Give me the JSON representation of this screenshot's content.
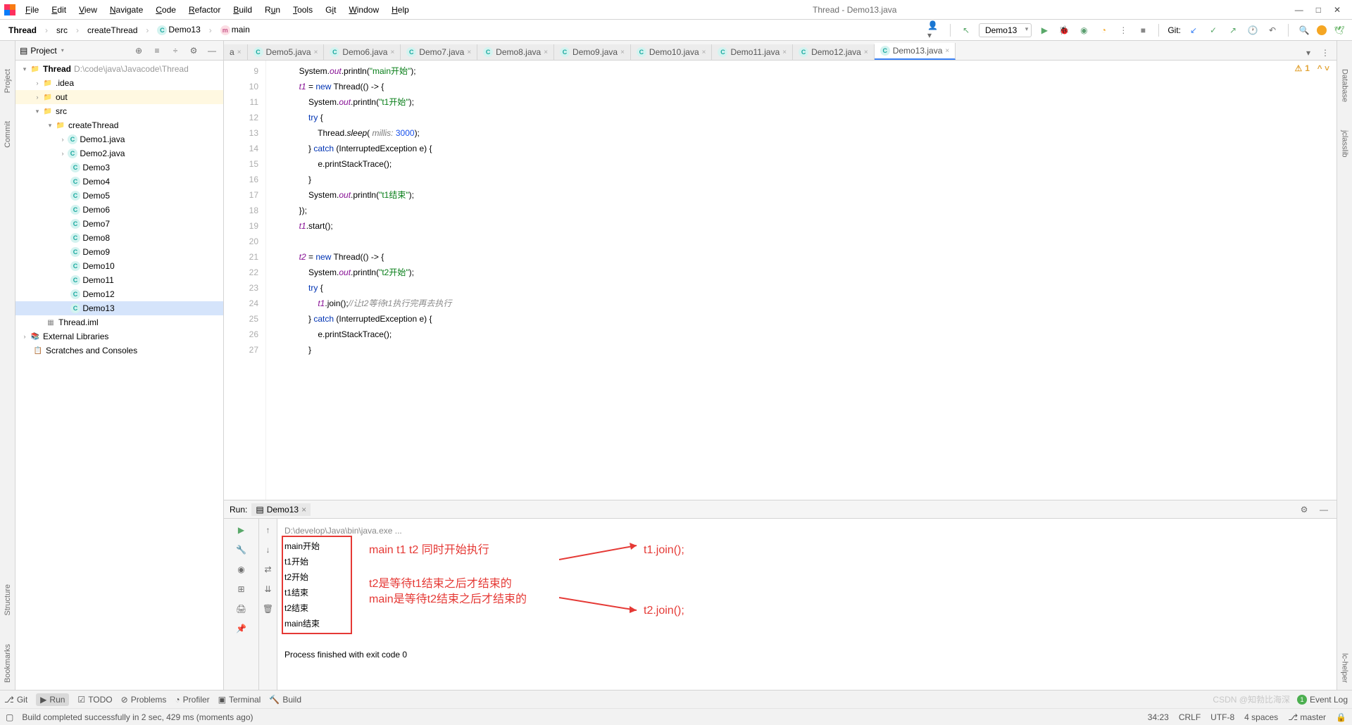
{
  "window": {
    "title": "Thread - Demo13.java"
  },
  "menu": [
    "File",
    "Edit",
    "View",
    "Navigate",
    "Code",
    "Refactor",
    "Build",
    "Run",
    "Tools",
    "Git",
    "Window",
    "Help"
  ],
  "breadcrumb": {
    "root": "Thread",
    "src": "src",
    "pkg": "createThread",
    "cls": "Demo13",
    "method": "main"
  },
  "runConfig": "Demo13",
  "gitLabel": "Git:",
  "project": {
    "title": "Project",
    "root": "Thread",
    "rootPath": "D:\\code\\java\\Javacode\\Thread",
    "idea": ".idea",
    "out": "out",
    "src": "src",
    "pkg": "createThread",
    "files": [
      "Demo1.java",
      "Demo2.java",
      "Demo3",
      "Demo4",
      "Demo5",
      "Demo6",
      "Demo7",
      "Demo8",
      "Demo9",
      "Demo10",
      "Demo11",
      "Demo12",
      "Demo13"
    ],
    "iml": "Thread.iml",
    "ext": "External Libraries",
    "scratch": "Scratches and Consoles"
  },
  "tabs": [
    {
      "label": "a"
    },
    {
      "label": "Demo5.java"
    },
    {
      "label": "Demo6.java"
    },
    {
      "label": "Demo7.java"
    },
    {
      "label": "Demo8.java"
    },
    {
      "label": "Demo9.java"
    },
    {
      "label": "Demo10.java"
    },
    {
      "label": "Demo11.java"
    },
    {
      "label": "Demo12.java"
    },
    {
      "label": "Demo13.java",
      "active": true
    }
  ],
  "warnCount": "1",
  "code": {
    "lines": [
      9,
      10,
      11,
      12,
      13,
      14,
      15,
      16,
      17,
      18,
      19,
      20,
      21,
      22,
      23,
      24,
      25,
      26,
      27
    ],
    "l9": "System.out.println(\"main开始\");",
    "l10_a": "t1",
    " l10_b": " = ",
    " l10_c": "new",
    " l10_d": " Thread(() -> {",
    "l11": "System.out.println(\"t1开始\");",
    "l12": "try {",
    "l13_a": "Thread.sleep( ",
    "l13_b": "millis: ",
    "l13_c": "3000",
    "l13_d": ");",
    "l14": "} catch (InterruptedException e) {",
    "l15": "e.printStackTrace();",
    "l16": "}",
    "l17": "System.out.println(\"t1结束\");",
    "l18": "});",
    "l19": "t1.start();",
    "l21_a": "t2",
    "l21_b": " = ",
    "l21_c": "new",
    "l21_d": " Thread(() -> {",
    "l22": "System.out.println(\"t2开始\");",
    "l23": "try {",
    "l24_a": "t1",
    "l24_b": ".join();",
    "l24_c": "//让t2等待t1执行完再去执行",
    "l25": "} catch (InterruptedException e) {",
    "l26": "e.printStackTrace();",
    "l27": "}"
  },
  "run": {
    "label": "Run:",
    "name": "Demo13",
    "cmd": "D:\\develop\\Java\\bin\\java.exe ...",
    "out": [
      "main开始",
      "t1开始",
      "t2开始",
      "t1结束",
      "t2结束",
      "main结束"
    ],
    "exit": "Process finished with exit code 0"
  },
  "annotations": {
    "a1": "main t1 t2 同时开始执行",
    "a2": "t2是等待t1结束之后才结束的",
    "a3": "main是等待t2结束之后才结束的",
    "j1": "t1.join();",
    "j2": "t2.join();"
  },
  "bottomTabs": {
    "git": "Git",
    "run": "Run",
    "todo": "TODO",
    "problems": "Problems",
    "profiler": "Profiler",
    "terminal": "Terminal",
    "build": "Build",
    "eventLog": "Event Log"
  },
  "status": {
    "msg": "Build completed successfully in 2 sec, 429 ms (moments ago)",
    "pos": "34:23",
    "sep": "CRLF",
    "enc": "UTF-8",
    "indent": "4 spaces",
    "branch": "master",
    "watermark": "CSDN @知勃比海深"
  }
}
